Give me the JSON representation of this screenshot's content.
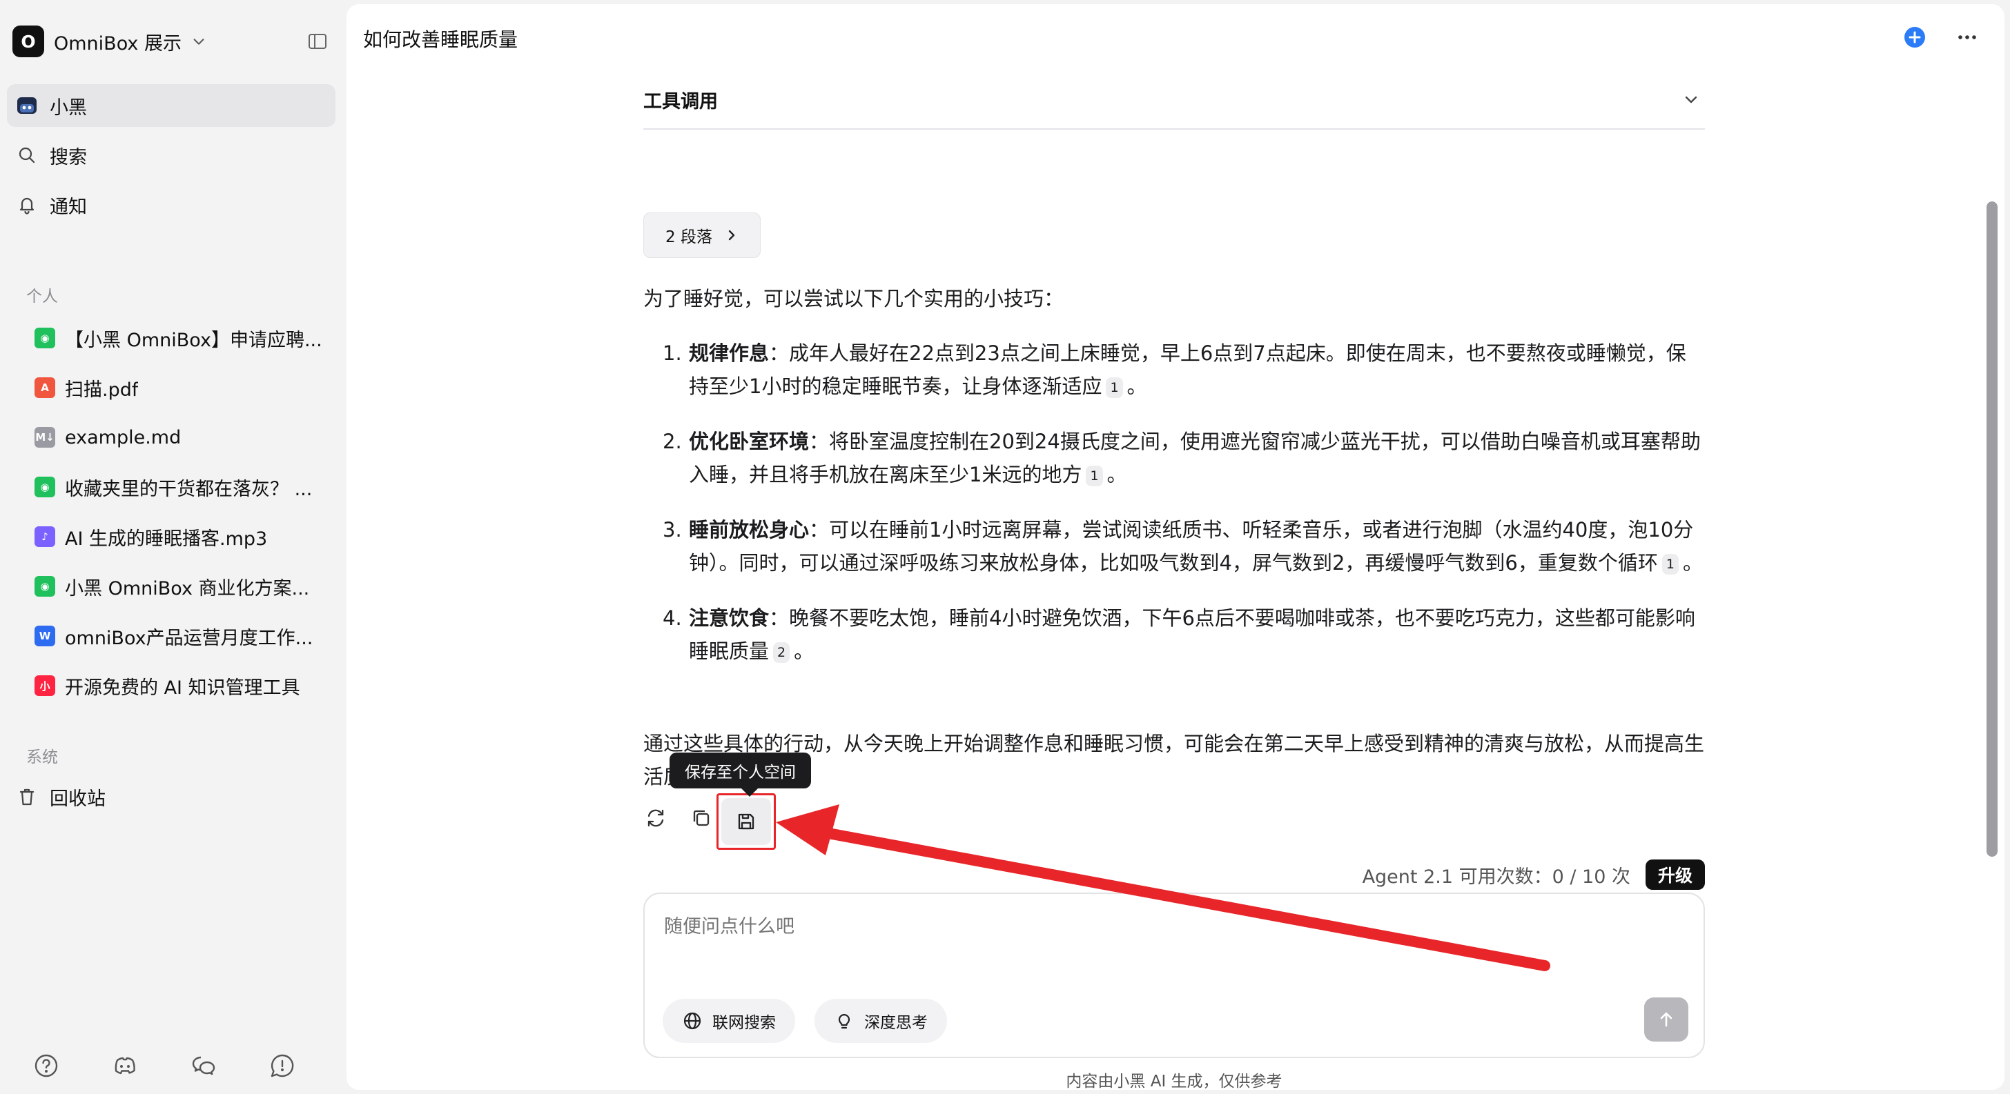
{
  "workspace": {
    "logo_letter": "O",
    "name": "OmniBox 展示"
  },
  "nav": {
    "assistant": "小黑",
    "search": "搜索",
    "notifications": "通知"
  },
  "sections": {
    "personal": "个人",
    "system": "系统"
  },
  "files": [
    {
      "label": "【小黑 OmniBox】申请应聘...",
      "icon": "wechat-icon",
      "color": "#20c05c"
    },
    {
      "label": "扫描.pdf",
      "icon": "pdf-icon",
      "color": "#f0553d"
    },
    {
      "label": "example.md",
      "icon": "markdown-icon",
      "color": "#9a9aa2"
    },
    {
      "label": "收藏夹里的干货都在落灰？ ...",
      "icon": "wechat-icon",
      "color": "#20c05c"
    },
    {
      "label": "AI 生成的睡眠播客.mp3",
      "icon": "audio-icon",
      "color": "#7b61ff"
    },
    {
      "label": "小黑 OmniBox 商业化方案...",
      "icon": "wechat-icon",
      "color": "#20c05c"
    },
    {
      "label": "omniBox产品运营月度工作...",
      "icon": "word-icon",
      "color": "#2d6cf0"
    },
    {
      "label": "开源免费的 AI 知识管理工具",
      "icon": "xiaohongshu-icon",
      "color": "#ff2442"
    }
  ],
  "trash": "回收站",
  "chat": {
    "title": "如何改善睡眠质量",
    "tool_call_label": "工具调用",
    "paragraph_chip": "2 段落",
    "intro": "为了睡好觉，可以尝试以下几个实用的小技巧：",
    "tips": [
      {
        "num": "1.",
        "title": "规律作息",
        "text": "：成年人最好在22点到23点之间上床睡觉，早上6点到7点起床。即使在周末，也不要熬夜或睡懒觉，保持至少1小时的稳定睡眠节奏，让身体逐渐适应",
        "cite": "1",
        "end": "。"
      },
      {
        "num": "2.",
        "title": "优化卧室环境",
        "text": "：将卧室温度控制在20到24摄氏度之间，使用遮光窗帘减少蓝光干扰，可以借助白噪音机或耳塞帮助入睡，并且将手机放在离床至少1米远的地方",
        "cite": "1",
        "end": "。"
      },
      {
        "num": "3.",
        "title": "睡前放松身心",
        "text": "：可以在睡前1小时远离屏幕，尝试阅读纸质书、听轻柔音乐，或者进行泡脚（水温约40度，泡10分钟）。同时，可以通过深呼吸练习来放松身体，比如吸气数到4，屏气数到2，再缓慢呼气数到6，重复数个循环",
        "cite": "1",
        "end": "。"
      },
      {
        "num": "4.",
        "title": "注意饮食",
        "text": "：晚餐不要吃太饱，睡前4小时避免饮酒，下午6点后不要喝咖啡或茶，也不要吃巧克力，这些都可能影响睡眠质量",
        "cite": "2",
        "end": "。"
      }
    ],
    "outro": "通过这些具体的行动，从今天晚上开始调整作息和睡眠习惯，可能会在第二天早上感受到精神的清爽与放松，从而提高生活质量。",
    "tooltip": "保存至个人空间",
    "quota_text": "Agent 2.1 可用次数：0 / 10 次",
    "upgrade": "升级",
    "input_placeholder": "随便问点什么吧",
    "web_search": "联网搜索",
    "deep_think": "深度思考",
    "footer": "内容由小黑 AI 生成，仅供参考"
  },
  "colors": {
    "accent_blue": "#2b7cf6",
    "highlight_red": "#e8262a"
  }
}
